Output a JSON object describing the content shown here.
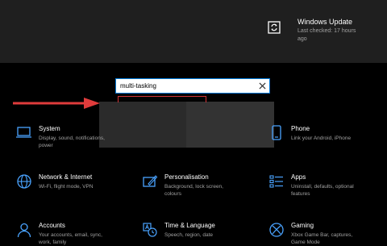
{
  "windows_update": {
    "title": "Windows Update",
    "subtitle": "Last checked: 17 hours ago"
  },
  "search": {
    "value": "multi-tasking"
  },
  "tiles": [
    {
      "title": "System",
      "desc": "Display, sound, notifications, power",
      "icon": "laptop-icon"
    },
    {
      "title": "Phone",
      "desc": "Link your Android, iPhone",
      "icon": "phone-icon"
    },
    {
      "title": "Network & Internet",
      "desc": "Wi-Fi, flight mode, VPN",
      "icon": "globe-icon"
    },
    {
      "title": "Personalisation",
      "desc": "Background, lock screen, colours",
      "icon": "brush-icon"
    },
    {
      "title": "Apps",
      "desc": "Uninstall, defaults, optional features",
      "icon": "apps-icon"
    },
    {
      "title": "Accounts",
      "desc": "Your accounts, email, sync, work, family",
      "icon": "person-icon"
    },
    {
      "title": "Time & Language",
      "desc": "Speech, region, date",
      "icon": "time-language-icon"
    },
    {
      "title": "Gaming",
      "desc": "Xbox Game Bar, captures, Game Mode",
      "icon": "xbox-icon"
    }
  ],
  "colors": {
    "accent": "#0078d7",
    "annotation_arrow": "#e03c3c",
    "highlight_border": "#d13438"
  }
}
